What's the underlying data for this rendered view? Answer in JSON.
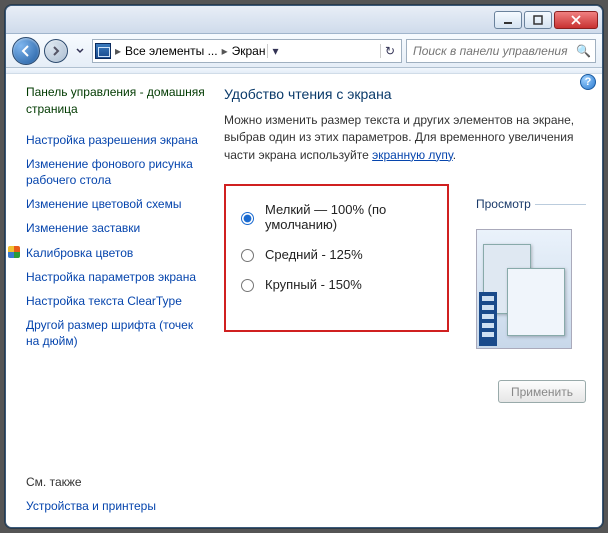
{
  "titlebar": {
    "min_tip": "Свернуть",
    "max_tip": "Развернуть",
    "close_tip": "Закрыть"
  },
  "addressbar": {
    "back_tip": "Назад",
    "fwd_tip": "Вперёд",
    "crumb1": "Все элементы ...",
    "crumb2": "Экран",
    "refresh_tip": "Обновить"
  },
  "search": {
    "placeholder": "Поиск в панели управления"
  },
  "sidebar": {
    "home": "Панель управления - домашняя страница",
    "items": [
      "Настройка разрешения экрана",
      "Изменение фонового рисунка рабочего стола",
      "Изменение цветовой схемы",
      "Изменение заставки",
      "Калибровка цветов",
      "Настройка параметров экрана",
      "Настройка текста ClearType",
      "Другой размер шрифта (точек на дюйм)"
    ],
    "seealso_hdr": "См. также",
    "seealso_link": "Устройства и принтеры"
  },
  "main": {
    "heading": "Удобство чтения с экрана",
    "desc_pre": "Можно изменить размер текста и других элементов на экране, выбрав один из этих параметров. Для временного увеличения части экрана используйте ",
    "desc_link": "экранную лупу",
    "desc_post": ".",
    "options": [
      "Мелкий — 100% (по умолчанию)",
      "Средний - 125%",
      "Крупный - 150%"
    ],
    "preview_hdr": "Просмотр",
    "apply": "Применить"
  }
}
